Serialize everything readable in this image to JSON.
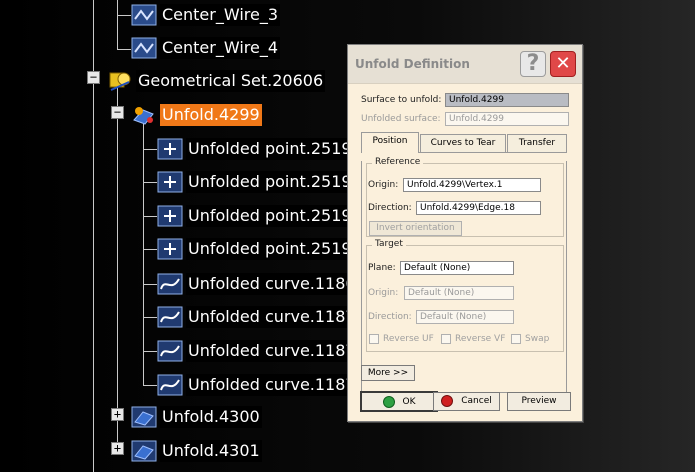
{
  "tree": {
    "nodes": [
      {
        "id": "center-wire-3",
        "label": "Center_Wire_3",
        "icon": "wire-icon"
      },
      {
        "id": "center-wire-4",
        "label": "Center_Wire_4",
        "icon": "wire-icon"
      },
      {
        "id": "geometrical-set",
        "label": "Geometrical Set.20606",
        "icon": "geometrical-set-icon",
        "expander": "−"
      },
      {
        "id": "unfold-4299",
        "label": "Unfold.4299",
        "icon": "unfold-icon",
        "expander": "−",
        "selected": true
      },
      {
        "id": "unfolded-point-25193",
        "label": "Unfolded point.25193",
        "icon": "point-icon"
      },
      {
        "id": "unfolded-point-25194",
        "label": "Unfolded point.25194",
        "icon": "point-icon"
      },
      {
        "id": "unfolded-point-25195",
        "label": "Unfolded point.25195",
        "icon": "point-icon"
      },
      {
        "id": "unfolded-point-25196",
        "label": "Unfolded point.25196",
        "icon": "point-icon"
      },
      {
        "id": "unfolded-curve-11869",
        "label": "Unfolded curve.11869",
        "icon": "curve-icon"
      },
      {
        "id": "unfolded-curve-11870",
        "label": "Unfolded curve.11870",
        "icon": "curve-icon"
      },
      {
        "id": "unfolded-curve-11871",
        "label": "Unfolded curve.11871",
        "icon": "curve-icon"
      },
      {
        "id": "unfolded-curve-11872",
        "label": "Unfolded curve.11872",
        "icon": "curve-icon"
      },
      {
        "id": "unfold-4300",
        "label": "Unfold.4300",
        "icon": "unfold-icon",
        "expander": "+"
      },
      {
        "id": "unfold-4301",
        "label": "Unfold.4301",
        "icon": "unfold-icon",
        "expander": "+"
      }
    ]
  },
  "dialog": {
    "title": "Unfold Definition",
    "help_label": "?",
    "close_label": "✕",
    "surface_label": "Surface to unfold:",
    "surface_value": "Unfold.4299",
    "unfolded_surface_label": "Unfolded surface:",
    "unfolded_surface_value": "Unfold.4299",
    "tabs": [
      "Position",
      "Curves to Tear",
      "Transfer"
    ],
    "active_tab": "Position",
    "reference": {
      "title": "Reference",
      "origin_label": "Origin:",
      "origin_value": "Unfold.4299\\Vertex.1",
      "direction_label": "Direction:",
      "direction_value": "Unfold.4299\\Edge.18",
      "invert_label": "Invert orientation"
    },
    "target": {
      "title": "Target",
      "plane_label": "Plane:",
      "plane_value": "Default (None)",
      "origin_label": "Origin:",
      "origin_value": "Default (None)",
      "direction_label": "Direction:",
      "direction_value": "Default (None)",
      "reverse_uf_label": "Reverse UF",
      "reverse_vf_label": "Reverse VF",
      "swap_label": "Swap"
    },
    "more_label": "More >>",
    "ok_label": "OK",
    "cancel_label": "Cancel",
    "preview_label": "Preview",
    "colors": {
      "ok_dot": "#2ea043",
      "cancel_dot": "#d02020",
      "selected": "#f07818"
    }
  }
}
